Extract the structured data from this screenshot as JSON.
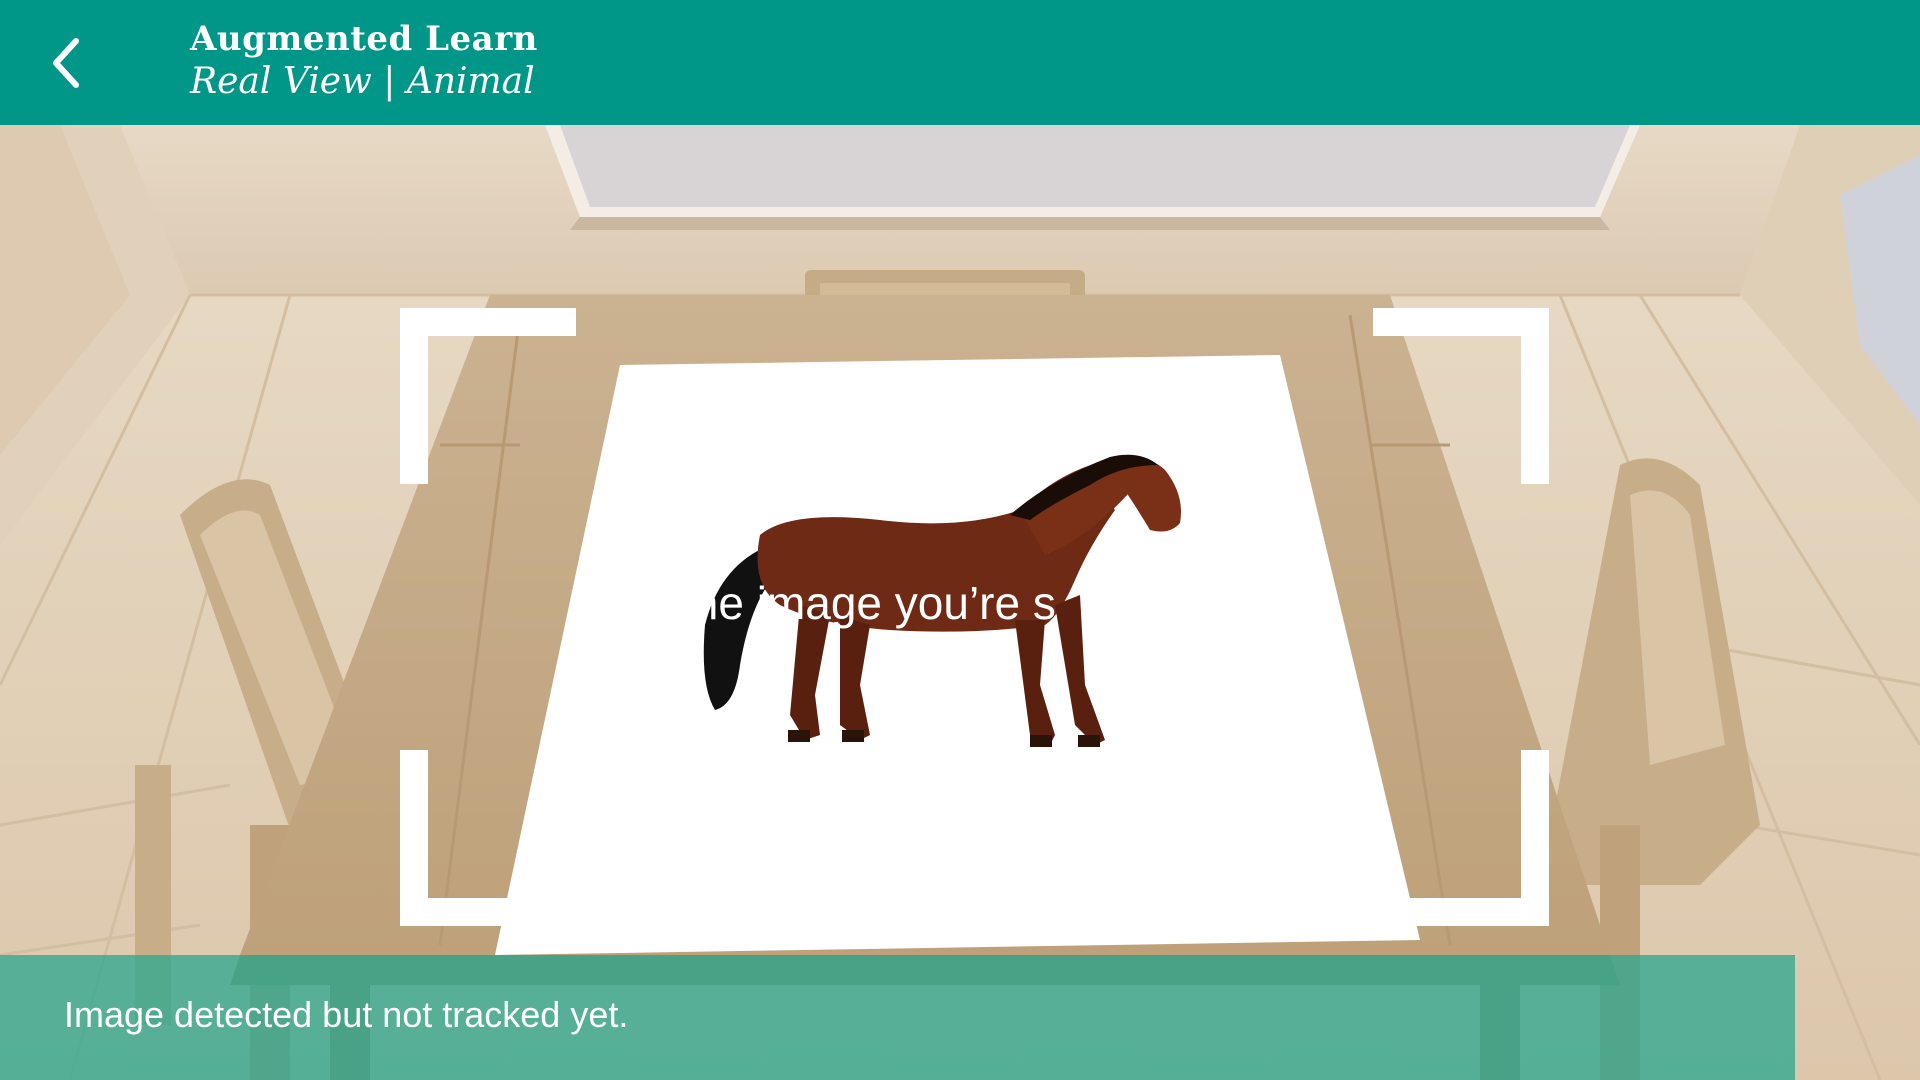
{
  "header": {
    "back_icon": "chevron-left-icon",
    "title": "Augmented Learn",
    "subtitle": "Real View | Animal"
  },
  "scan": {
    "hint": "the image you’re s",
    "target_image": "horse"
  },
  "status": {
    "message": "Image detected but not tracked yet."
  },
  "colors": {
    "header": "#009688",
    "status_bar": "#30a890",
    "frame": "#ffffff"
  }
}
